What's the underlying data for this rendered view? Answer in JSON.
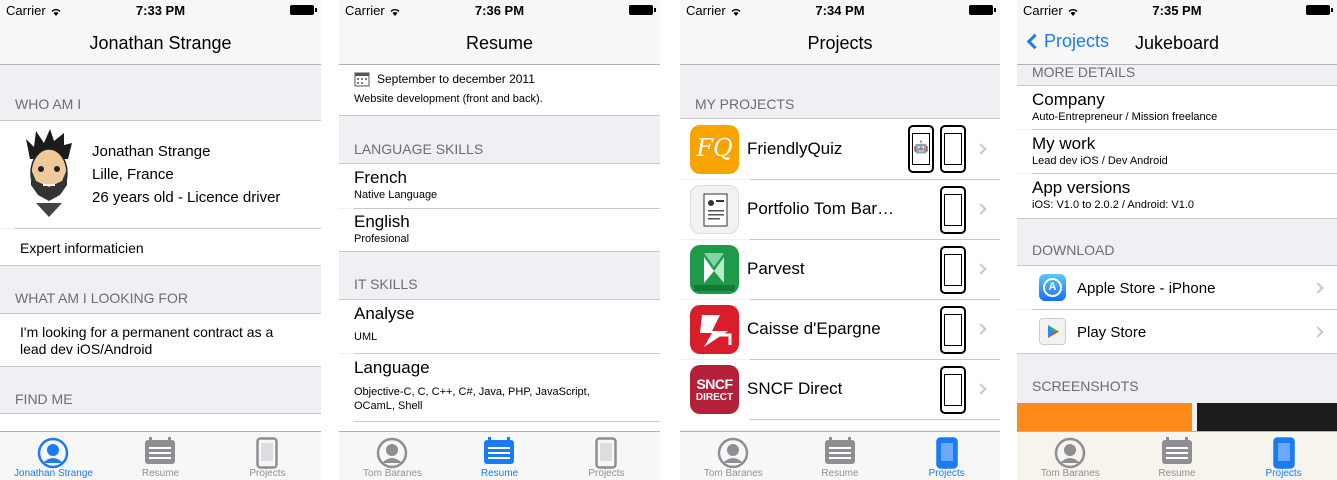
{
  "status": {
    "carrier": "Carrier"
  },
  "screens": {
    "s1": {
      "time": "7:33 PM",
      "nav_title": "Jonathan Strange",
      "who_header": "WHO AM I",
      "profile_lines": [
        "Jonathan Strange",
        "Lille, France",
        "26 years old - Licence driver"
      ],
      "job_title": "Expert informaticien",
      "looking_header": "WHAT AM I LOOKING FOR",
      "looking_text": "I'm looking for a permanent contract as a lead dev iOS/Android",
      "find_header": "FIND ME",
      "tabs": [
        "Jonathan Strange",
        "Resume",
        "Projects"
      ]
    },
    "s2": {
      "time": "7:36 PM",
      "nav_title": "Resume",
      "date_text": "September to december 2011",
      "job_desc": "Website development (front and back).",
      "lang_header": "LANGUAGE SKILLS",
      "languages": [
        {
          "name": "French",
          "level": "Native Language"
        },
        {
          "name": "English",
          "level": "Profesional"
        }
      ],
      "it_header": "IT SKILLS",
      "it_skills": [
        {
          "name": "Analyse",
          "detail": "UML"
        },
        {
          "name": "Language",
          "detail": "Objective-C, C, C++, C#, Java, PHP, JavaScript, OCamL, Shell"
        }
      ],
      "tabs": [
        "Tom Baranes",
        "Resume",
        "Projects"
      ]
    },
    "s3": {
      "time": "7:34 PM",
      "nav_title": "Projects",
      "section_header": "MY PROJECTS",
      "projects": [
        {
          "name": "FriendlyQuiz",
          "platforms": [
            "android",
            "apple"
          ],
          "icon_color": "#f7a400"
        },
        {
          "name": "Portfolio Tom Bar…",
          "platforms": [
            "apple"
          ],
          "icon_color": "#f2f2f2"
        },
        {
          "name": "Parvest",
          "platforms": [
            "apple"
          ],
          "icon_color": "#1f9a4a"
        },
        {
          "name": "Caisse d'Epargne",
          "platforms": [
            "apple"
          ],
          "icon_color": "#d81e2a"
        },
        {
          "name": "SNCF Direct",
          "platforms": [
            "apple"
          ],
          "icon_color": "#b2203a"
        }
      ],
      "tabs": [
        "Tom Baranes",
        "Resume",
        "Projects"
      ]
    },
    "s4": {
      "time": "7:35 PM",
      "back_label": "Projects",
      "nav_title": "Jukeboard",
      "more_header": "MORE DETAILS",
      "details": [
        {
          "title": "Company",
          "sub": "Auto-Entrepreneur / Mission freelance"
        },
        {
          "title": "My work",
          "sub": "Lead dev iOS / Dev Android"
        },
        {
          "title": "App versions",
          "sub": "iOS: V1.0 to 2.0.2 / Android: V1.0"
        }
      ],
      "download_header": "DOWNLOAD",
      "downloads": [
        "Apple Store - iPhone",
        "Play Store"
      ],
      "screens_header": "SCREENSHOTS",
      "tabs": [
        "Tom Baranes",
        "Resume",
        "Projects"
      ]
    }
  },
  "colors": {
    "accent": "#1a7cf5",
    "inactive": "#929292"
  }
}
